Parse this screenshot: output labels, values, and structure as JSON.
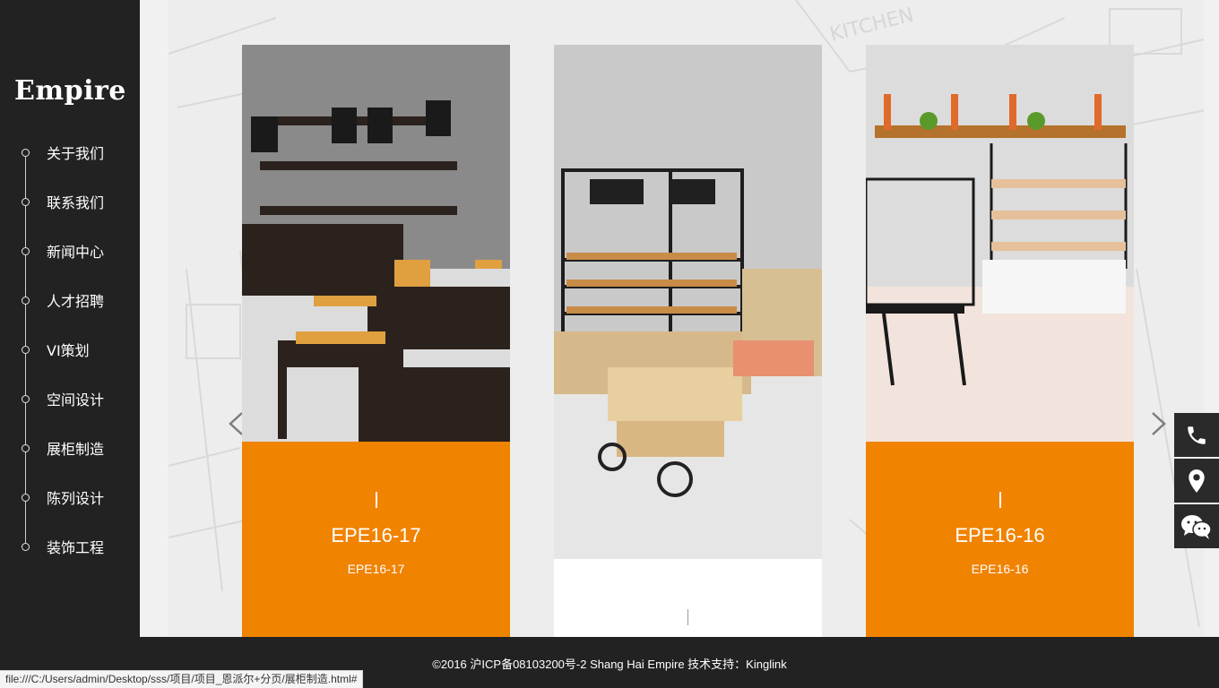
{
  "brand": {
    "logo": "Empire"
  },
  "nav": {
    "items": [
      {
        "label": "关于我们"
      },
      {
        "label": "联系我们"
      },
      {
        "label": "新闻中心"
      },
      {
        "label": "人才招聘"
      },
      {
        "label": "VI策划"
      },
      {
        "label": "空间设计"
      },
      {
        "label": "展柜制造"
      },
      {
        "label": "陈列设计"
      },
      {
        "label": "装饰工程"
      }
    ]
  },
  "carousel": {
    "prev_icon": "chevron-left-icon",
    "next_icon": "chevron-right-icon",
    "cards": [
      {
        "title": "EPE16-17",
        "subtitle": "EPE16-17",
        "caption_color": "#f08300"
      },
      {
        "title": "",
        "subtitle": ""
      },
      {
        "title": "EPE16-16",
        "subtitle": "EPE16-16",
        "caption_color": "#f08300"
      }
    ]
  },
  "widgets": [
    {
      "icon": "phone-icon"
    },
    {
      "icon": "location-pin-icon"
    },
    {
      "icon": "wechat-icon"
    }
  ],
  "footer": {
    "text": "©2016  沪ICP备08103200号-2 Shang  Hai  Empire  技术支持：Kinglink"
  },
  "status_bar": {
    "url": "file:///C:/Users/admin/Desktop/sss/项目/项目_恩派尔+分页/展柜制造.html#"
  },
  "colors": {
    "accent": "#f08300",
    "sidebar": "#222222",
    "footer": "#222222"
  }
}
